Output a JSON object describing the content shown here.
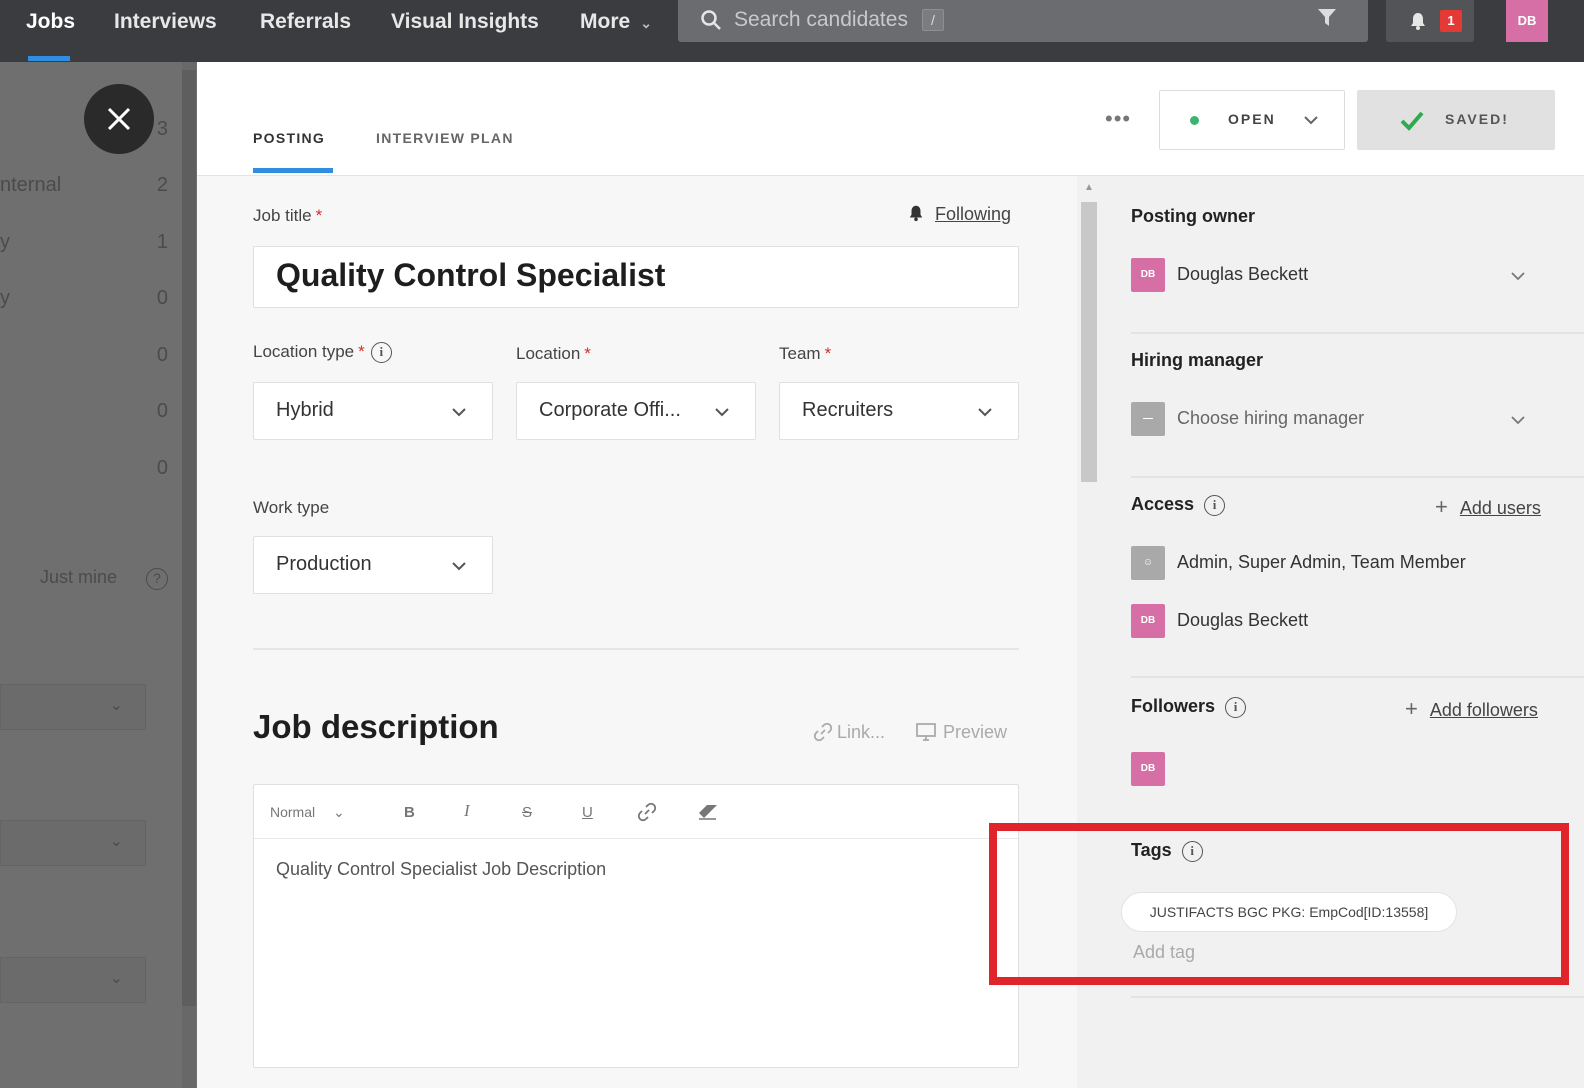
{
  "nav": {
    "items": [
      {
        "label": "Jobs",
        "active": true
      },
      {
        "label": "Interviews"
      },
      {
        "label": "Referrals"
      },
      {
        "label": "Visual Insights"
      },
      {
        "label": "More"
      }
    ],
    "search_placeholder": "Search candidates",
    "search_shortcut": "/",
    "notification_count": "1",
    "user_initials": "DB",
    "accent_color": "#2f8ee0"
  },
  "background_panel": {
    "rows": [
      {
        "label": "",
        "count": "3"
      },
      {
        "label": "nternal",
        "count": "2"
      },
      {
        "label": "y",
        "count": "1"
      },
      {
        "label": "y",
        "count": "0"
      },
      {
        "label": "",
        "count": "0"
      },
      {
        "label": "",
        "count": "0"
      },
      {
        "label": "",
        "count": "0"
      }
    ],
    "just_mine": "Just mine",
    "help": "?"
  },
  "tabs": [
    "POSTING",
    "INTERVIEW PLAN"
  ],
  "header": {
    "more_dots": "•••",
    "status": "OPEN",
    "status_color": "#3cb371",
    "saved": "SAVED!"
  },
  "form": {
    "job_title_label": "Job title",
    "job_title_value": "Quality Control Specialist",
    "following": "Following",
    "location_type_label": "Location type",
    "location_type_value": "Hybrid",
    "location_label": "Location",
    "location_value": "Corporate Offi...",
    "team_label": "Team",
    "team_value": "Recruiters",
    "work_type_label": "Work type",
    "work_type_value": "Production",
    "required_mark": "*",
    "info_mark": "i"
  },
  "description": {
    "title": "Job description",
    "link": "Link...",
    "preview": "Preview",
    "toolbar": {
      "style": "Normal",
      "bold": "B",
      "italic": "I",
      "strike": "S",
      "underline": "U"
    },
    "body": "Quality Control Specialist Job Description"
  },
  "sidebar": {
    "posting_owner_label": "Posting owner",
    "posting_owner": "Douglas Beckett",
    "hiring_manager_label": "Hiring manager",
    "hiring_manager_placeholder": "Choose hiring manager",
    "access_label": "Access",
    "add_users": "Add users",
    "access_roles": "Admin, Super Admin, Team Member",
    "access_user": "Douglas Beckett",
    "followers_label": "Followers",
    "add_followers": "Add followers",
    "tags_label": "Tags",
    "tag": "JUSTIFACTS BGC PKG: EmpCod[ID:13558]",
    "add_tag": "Add tag",
    "avatar_initials": "DB",
    "highlight_color": "#e0242b"
  }
}
